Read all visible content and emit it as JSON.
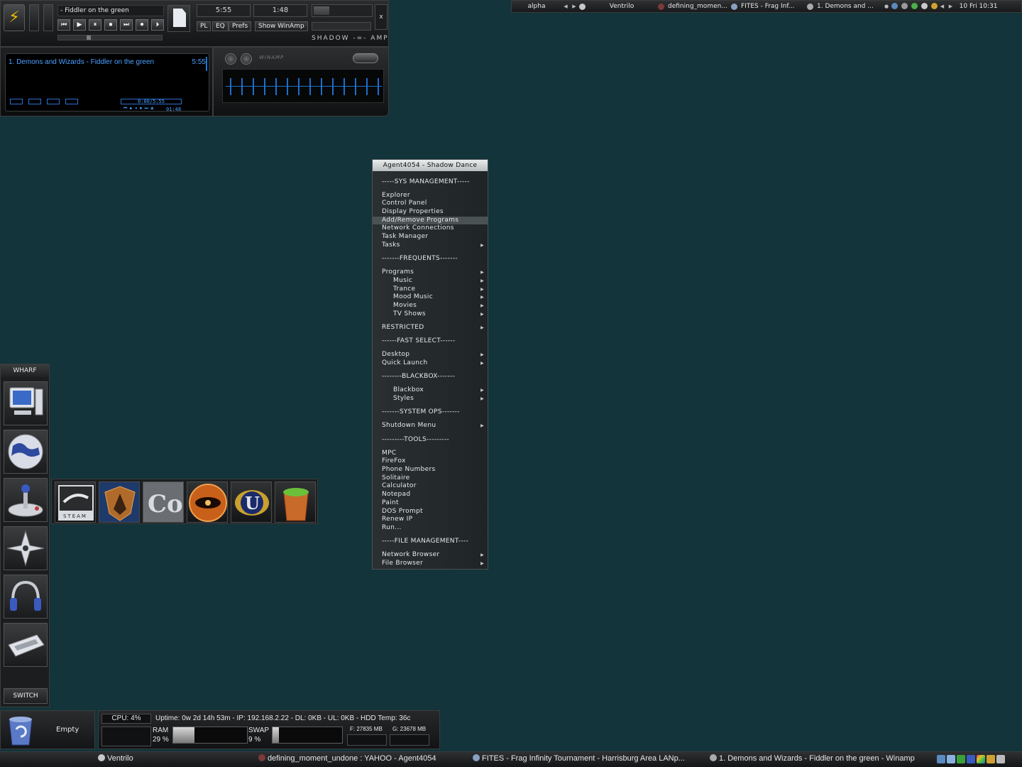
{
  "winamp": {
    "track_title": "- Fiddler on the green",
    "time_total": "5:55",
    "time_elapsed": "1:48",
    "buttons": {
      "pl": "PL",
      "eq": "EQ",
      "prefs": "Prefs",
      "show": "Show WinAmp"
    },
    "close": "x",
    "brand": "SHADOW -=- AMP",
    "controls": [
      "⏮",
      "▶",
      "⏸",
      "⏹",
      "⏭",
      "⏺",
      "⏵"
    ]
  },
  "playlist": {
    "item": "1. Demons and Wizards - Fiddler on the green",
    "item_len": "5:55",
    "time_box": "0:00/5:55",
    "ctrl_row": "⏮ ▶ ⏸ ⏹ ⏭ ⏏",
    "elapsed": "01:48"
  },
  "eq": {
    "logo": "WINAMP"
  },
  "topbar": {
    "workspace": "alpha",
    "tasks": [
      "Ventrilo",
      "defining_momen...",
      "FITES - Frag Inf...",
      "1. Demons and ..."
    ],
    "clock": "10 Fri 10:31"
  },
  "menu": {
    "title": "Agent4054 - Shadow Dance",
    "items": [
      {
        "label": "-----SYS MANAGEMENT-----",
        "kind": "sep"
      },
      {
        "label": "Explorer"
      },
      {
        "label": "Control Panel"
      },
      {
        "label": "Display Properties"
      },
      {
        "label": "Add/Remove Programs",
        "hl": true
      },
      {
        "label": "Network Connections"
      },
      {
        "label": "Task Manager"
      },
      {
        "label": "Tasks",
        "sub": true
      },
      {
        "label": "-------FREQUENTS-------",
        "kind": "sep"
      },
      {
        "label": "Programs",
        "sub": true
      },
      {
        "label": "Music",
        "sub": true,
        "indent": true
      },
      {
        "label": "Trance",
        "sub": true,
        "indent": true
      },
      {
        "label": "Mood Music",
        "sub": true,
        "indent": true
      },
      {
        "label": "Movies",
        "sub": true,
        "indent": true
      },
      {
        "label": "TV Shows",
        "sub": true,
        "indent": true
      },
      {
        "label": "RESTRICTED",
        "sub": true,
        "gap_before": true
      },
      {
        "label": "------FAST SELECT------",
        "kind": "sep"
      },
      {
        "label": "Desktop",
        "sub": true
      },
      {
        "label": "Quick Launch",
        "sub": true
      },
      {
        "label": "--------BLACKBOX-------",
        "kind": "sep"
      },
      {
        "label": "Blackbox",
        "sub": true,
        "indent": true
      },
      {
        "label": "Styles",
        "sub": true,
        "indent": true
      },
      {
        "label": "-------SYSTEM OPS-------",
        "kind": "sep"
      },
      {
        "label": "Shutdown Menu",
        "sub": true
      },
      {
        "label": "---------TOOLS---------",
        "kind": "sep"
      },
      {
        "label": "MPC"
      },
      {
        "label": "FireFox"
      },
      {
        "label": "Phone Numbers"
      },
      {
        "label": "Solitaire"
      },
      {
        "label": "Calculator"
      },
      {
        "label": "Notepad"
      },
      {
        "label": "Paint"
      },
      {
        "label": "DOS Prompt"
      },
      {
        "label": "Renew IP"
      },
      {
        "label": "Run..."
      },
      {
        "label": "-----FILE MANAGEMENT----",
        "kind": "sep"
      },
      {
        "label": "Network Browser",
        "sub": true
      },
      {
        "label": "File Browser",
        "sub": true
      }
    ]
  },
  "wharf": {
    "title": "WHARF",
    "switch": "SWITCH",
    "tiles": [
      "computer-icon",
      "globe-icon",
      "joystick-icon",
      "shuriken-icon",
      "headphones-icon",
      "keyboard-icon"
    ]
  },
  "games": {
    "steam_label": "STEAM",
    "coh_label": "CoH",
    "icons": [
      "steam-icon",
      "shield-emblem-icon",
      "coh-icon",
      "eye-emblem-icon",
      "unreal-icon",
      "bucket-icon"
    ]
  },
  "recycle": {
    "label": "Empty"
  },
  "sysmon": {
    "cpu": "CPU: 4%",
    "cpu_pct": 4,
    "stats": "Uptime: 0w 2d 14h 53m - IP: 192.168.2.22 - DL: 0KB - UL: 0KB - HDD Temp: 36c",
    "ram_label": "RAM",
    "ram_value": "29 %",
    "ram_pct": 29,
    "swap_label": "SWAP",
    "swap_value": "9 %",
    "swap_pct": 9,
    "drive_f": "F: 27835 MB",
    "drive_g": "G: 23678 MB"
  },
  "taskbar": {
    "tasks": [
      "Ventrilo",
      "defining_moment_undone : YAHOO - Agent4054",
      "FITES - Frag Infinity Tournament - Harrisburg Area LANp...",
      "1. Demons and Wizards - Fiddler on the green - Winamp"
    ]
  },
  "colors": {
    "desktop": "#12343a",
    "accent_blue": "#4aa0ff"
  }
}
